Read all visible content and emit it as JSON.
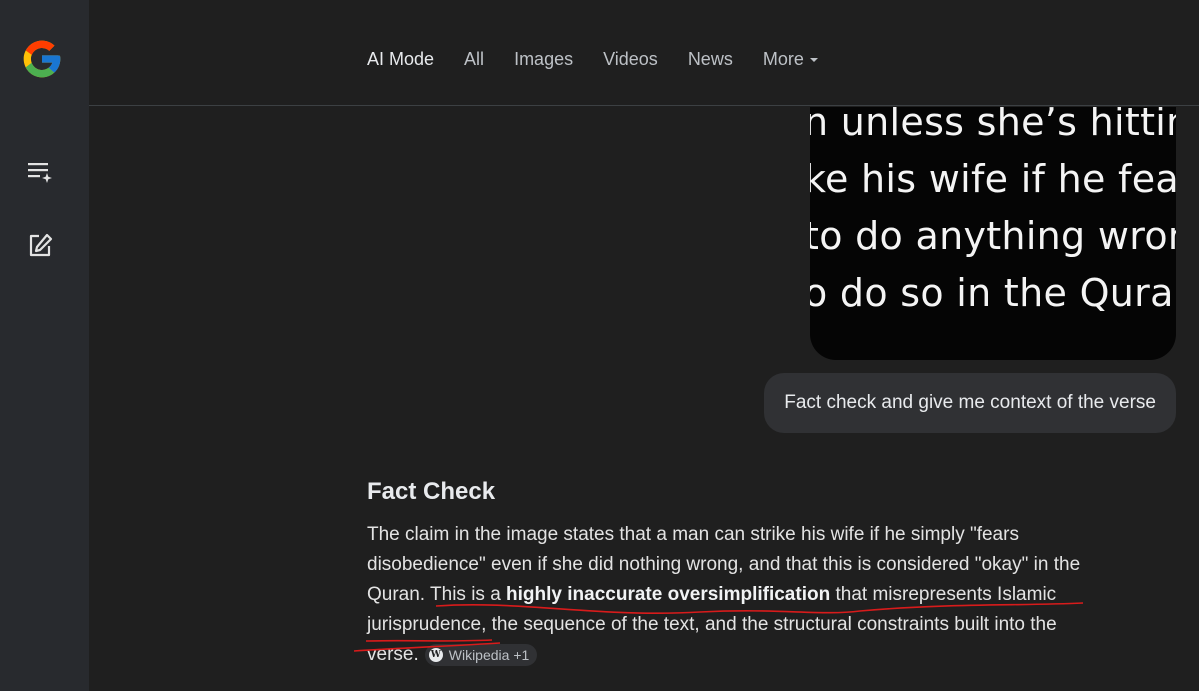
{
  "sidebar": {
    "logo_letter": "G",
    "icons": [
      "list-sparkle-icon",
      "new-chat-icon"
    ]
  },
  "header": {
    "tabs": [
      {
        "label": "AI Mode",
        "active": true
      },
      {
        "label": "All"
      },
      {
        "label": "Images"
      },
      {
        "label": "Videos"
      },
      {
        "label": "News"
      },
      {
        "label": "More"
      }
    ]
  },
  "attached_image": {
    "lines": [
      "n unless she’s hitting",
      "ke his wife if he fears",
      "to do anything wron",
      "o do so in the Quran"
    ]
  },
  "user_message": "Fact check and give me context of the verse",
  "answer": {
    "heading": "Fact Check",
    "p_start": "The claim in the image states that a man can strike his wife if he simply \"fears disobedience\" even if she did nothing wrong, and that this is considered \"okay\" in the Quran. This is a ",
    "p_bold": "highly inaccurate oversimplification",
    "p_end": " that misrepresents Islamic jurisprudence, the sequence of the text, and the structural constraints built into the verse.",
    "source_chip": "Wikipedia +1",
    "source_chip_icon": "W"
  },
  "colors": {
    "background": "#1f1f1f",
    "sidebar": "#282a2e",
    "annotation_red": "#d81b1b"
  }
}
